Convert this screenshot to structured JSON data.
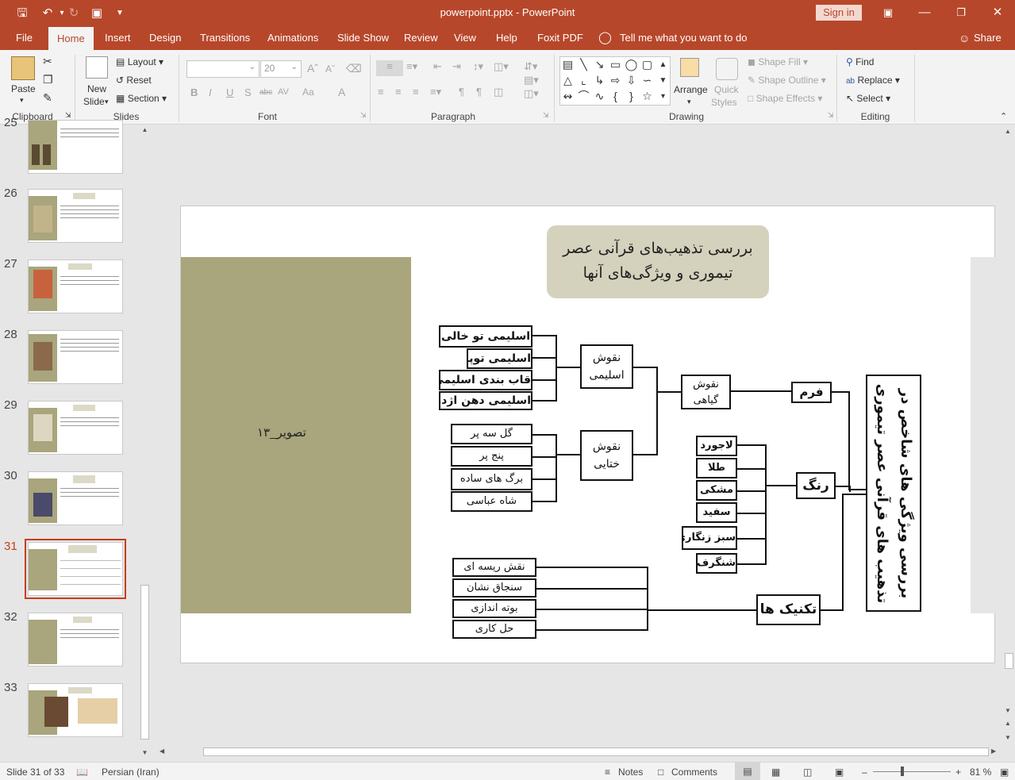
{
  "titlebar": {
    "title": "powerpoint.pptx  -  PowerPoint",
    "sign_in": "Sign in",
    "icons": [
      "save-icon",
      "undo-icon",
      "redo-icon",
      "present-icon",
      "customize-icon"
    ]
  },
  "tabs": [
    "File",
    "Home",
    "Insert",
    "Design",
    "Transitions",
    "Animations",
    "Slide Show",
    "Review",
    "View",
    "Help",
    "Foxit PDF"
  ],
  "active_tab": "Home",
  "tell_me": "Tell me what you want to do",
  "share": "Share",
  "ribbon": {
    "clipboard": {
      "label": "Clipboard",
      "paste": "Paste"
    },
    "slides": {
      "label": "Slides",
      "new_slide_1": "New",
      "new_slide_2": "Slide",
      "layout": "Layout",
      "reset": "Reset",
      "section": "Section"
    },
    "font": {
      "label": "Font",
      "font_name": "",
      "font_size": "20",
      "bold": "B",
      "italic": "I",
      "underline": "U",
      "shadow": "S",
      "strike": "abc",
      "spacing": "AV",
      "case": "Aa",
      "color": "A"
    },
    "paragraph": {
      "label": "Paragraph"
    },
    "drawing": {
      "label": "Drawing",
      "arrange": "Arrange",
      "quick_styles_1": "Quick",
      "quick_styles_2": "Styles",
      "shape_fill": "Shape Fill",
      "shape_outline": "Shape Outline",
      "shape_effects": "Shape Effects"
    },
    "editing": {
      "label": "Editing",
      "find": "Find",
      "replace": "Replace",
      "select": "Select"
    }
  },
  "thumbnails": [
    {
      "num": "25"
    },
    {
      "num": "26"
    },
    {
      "num": "27"
    },
    {
      "num": "28"
    },
    {
      "num": "29"
    },
    {
      "num": "30"
    },
    {
      "num": "31"
    },
    {
      "num": "32"
    },
    {
      "num": "33"
    }
  ],
  "slide": {
    "title_line1": "بررسی تذهیب‌های قرآنی عصر",
    "title_line2": "تیموری و ویژگی‌های آنها",
    "image_label": "تصویر_۱۳",
    "root": "بررسی ویژگی های شاخص در تذهیب های قرآنی عصر تیموری",
    "form": "فرم",
    "color": "رنگ",
    "technique": "تکنیک ها",
    "plant_motifs": "نقوش گیاهی",
    "eslimi_motifs": "نقوش اسلیمی",
    "khatai_motifs": "نقوش ختایی",
    "eslimi_items": [
      "اسلیمی تو خالی",
      "اسلیمی توپر",
      "قاب بندی اسلیمی",
      "اسلیمی دهن اژدری"
    ],
    "khatai_items": [
      "گل سه پر",
      "پنج پر",
      "برگ های ساده",
      "شاه عباسی"
    ],
    "color_items": [
      "لاجورد",
      "طلا",
      "مشکی",
      "سفید",
      "سبز زنگاری",
      "شنگرف"
    ],
    "technique_items": [
      "نقش ریسه ای",
      "سنجاق نشان",
      "بوته اندازی",
      "حل کاری"
    ]
  },
  "status": {
    "slide_info": "Slide 31 of 33",
    "language": "Persian (Iran)",
    "notes": "Notes",
    "comments": "Comments",
    "zoom": "81 %"
  }
}
